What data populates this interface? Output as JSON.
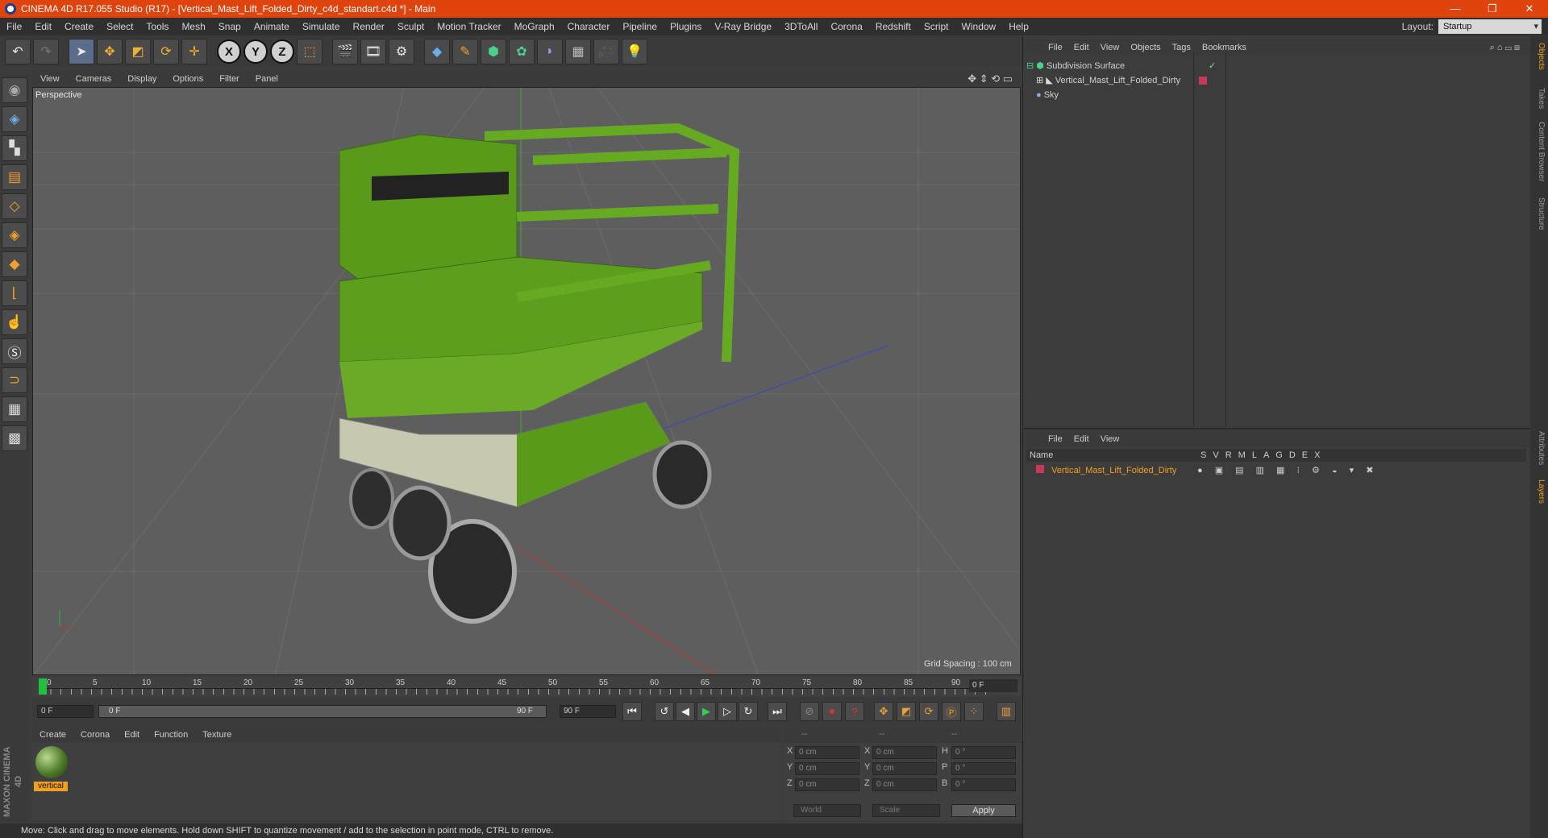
{
  "window": {
    "title": "CINEMA 4D R17.055 Studio (R17) - [Vertical_Mast_Lift_Folded_Dirty_c4d_standart.c4d *] - Main",
    "controls": [
      "—",
      "❐",
      "✕"
    ]
  },
  "menu": [
    "File",
    "Edit",
    "Create",
    "Select",
    "Tools",
    "Mesh",
    "Snap",
    "Animate",
    "Simulate",
    "Render",
    "Sculpt",
    "Motion Tracker",
    "MoGraph",
    "Character",
    "Pipeline",
    "Plugins",
    "V-Ray Bridge",
    "3DToAll",
    "Corona",
    "Redshift",
    "Script",
    "Window",
    "Help"
  ],
  "layout": {
    "label": "Layout:",
    "value": "Startup"
  },
  "toolbar": {
    "undo_icon": "undo-icon",
    "x": "X",
    "y": "Y",
    "z": "Z"
  },
  "viewport": {
    "menu": [
      "View",
      "Cameras",
      "Display",
      "Options",
      "Filter",
      "Panel"
    ],
    "camera_label": "Perspective",
    "grid_spacing": "Grid Spacing : 100 cm"
  },
  "timeline": {
    "ticks": [
      "0",
      "5",
      "10",
      "15",
      "20",
      "25",
      "30",
      "35",
      "40",
      "45",
      "50",
      "55",
      "60",
      "65",
      "70",
      "75",
      "80",
      "85",
      "90"
    ],
    "current_frame": "0 F"
  },
  "transport": {
    "start": "0 F",
    "slider_start": "0 F",
    "slider_end": "90 F",
    "end": "90 F"
  },
  "materials": {
    "menu": [
      "Create",
      "Corona",
      "Edit",
      "Function",
      "Texture"
    ],
    "items": [
      {
        "name": "vertical"
      }
    ]
  },
  "coordinates": {
    "headers": [
      "--",
      "--",
      "--"
    ],
    "rows": [
      {
        "a": "X",
        "av": "0 cm",
        "b": "X",
        "bv": "0 cm",
        "c": "H",
        "cv": "0 °"
      },
      {
        "a": "Y",
        "av": "0 cm",
        "b": "Y",
        "bv": "0 cm",
        "c": "P",
        "cv": "0 °"
      },
      {
        "a": "Z",
        "av": "0 cm",
        "b": "Z",
        "bv": "0 cm",
        "c": "B",
        "cv": "0 °"
      }
    ],
    "world": "World",
    "scale": "Scale",
    "apply": "Apply"
  },
  "status": "Move: Click and drag to move elements. Hold down SHIFT to quantize movement / add to the selection in point mode, CTRL to remove.",
  "objects": {
    "menu": [
      "File",
      "Edit",
      "View",
      "Objects",
      "Tags",
      "Bookmarks"
    ],
    "items": [
      {
        "name": "Subdivision Surface",
        "check": "✓"
      },
      {
        "name": "Vertical_Mast_Lift_Folded_Dirty",
        "check": ""
      },
      {
        "name": "Sky",
        "check": ""
      }
    ]
  },
  "layers": {
    "menu": [
      "File",
      "Edit",
      "View"
    ],
    "name_header": "Name",
    "flags": [
      "S",
      "V",
      "R",
      "M",
      "L",
      "A",
      "G",
      "D",
      "E",
      "X"
    ],
    "items": [
      {
        "name": "Vertical_Mast_Lift_Folded_Dirty"
      }
    ]
  },
  "side_tabs": [
    "Objects",
    "Takes",
    "Content Browser",
    "Structure",
    "Attributes",
    "Layers"
  ],
  "branding": "MAXON CINEMA 4D",
  "colors": {
    "accent": "#e0440e",
    "lift_green": "#5a9a1a",
    "layer_red": "#c8385a",
    "selected_orange": "#f0a020"
  }
}
